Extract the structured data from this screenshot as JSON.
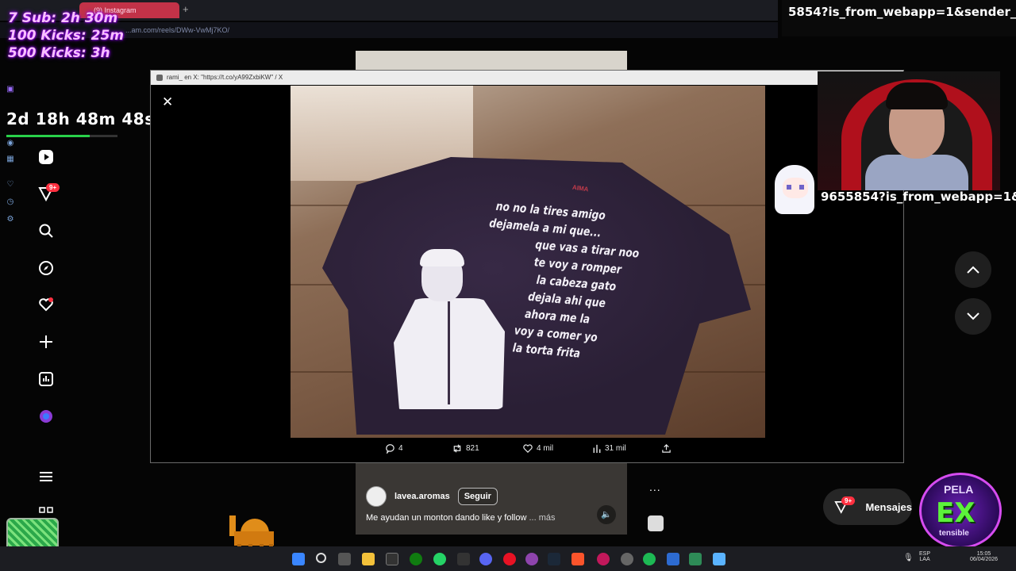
{
  "browser": {
    "tab_label": "(9) Instagram",
    "url": "...am.com/reels/DWw-VwMj7KO/"
  },
  "stream": {
    "goals": [
      "7 Sub: 2h 30m",
      "100 Kicks: 25m",
      "500 Kicks: 3h"
    ],
    "timer": "2d 18h 48m 48s",
    "timer_progress": 0.75,
    "chat_url_top": "5854?is_from_webapp=1&sender_dev",
    "chat_url_mid": "9655854?is_from_webapp=1&s"
  },
  "instagram": {
    "notif_badge": "9+",
    "reel": {
      "username": "lavea.aromas",
      "follow_label": "Seguir",
      "caption": "Me ayudan un monton dando like y follow",
      "more_label": "... más",
      "dots": "..."
    },
    "messages_label": "Mensajes",
    "messages_badge": "9+"
  },
  "x_popup": {
    "title": "rami_ en X: \"https://t.co/yA99ZxbiKW\" / X",
    "close_glyph": "✕",
    "shirt_brand": "AIMA",
    "shirt_lines": [
      "no no la tires amigo",
      "dejamela a mi que...",
      "que vas a tirar noo",
      "te voy a romper",
      "la cabeza gato",
      "dejala ahi que",
      "ahora  me la",
      "voy a comer yo",
      "la torta frita"
    ],
    "stats": {
      "replies": "4",
      "reposts": "821",
      "likes": "4 mil",
      "views": "31 mil"
    }
  },
  "taskbar": {
    "lang_1": "ESP",
    "lang_2": "LAA",
    "time": "15:05",
    "date": "06/04/2026"
  },
  "overlay_logo": {
    "top": "PELA",
    "center": "EX",
    "bottom": "tensible"
  },
  "colors": {
    "accent_red": "#ff3040",
    "tab_red": "#c23248",
    "timer_green": "#29d14a"
  }
}
